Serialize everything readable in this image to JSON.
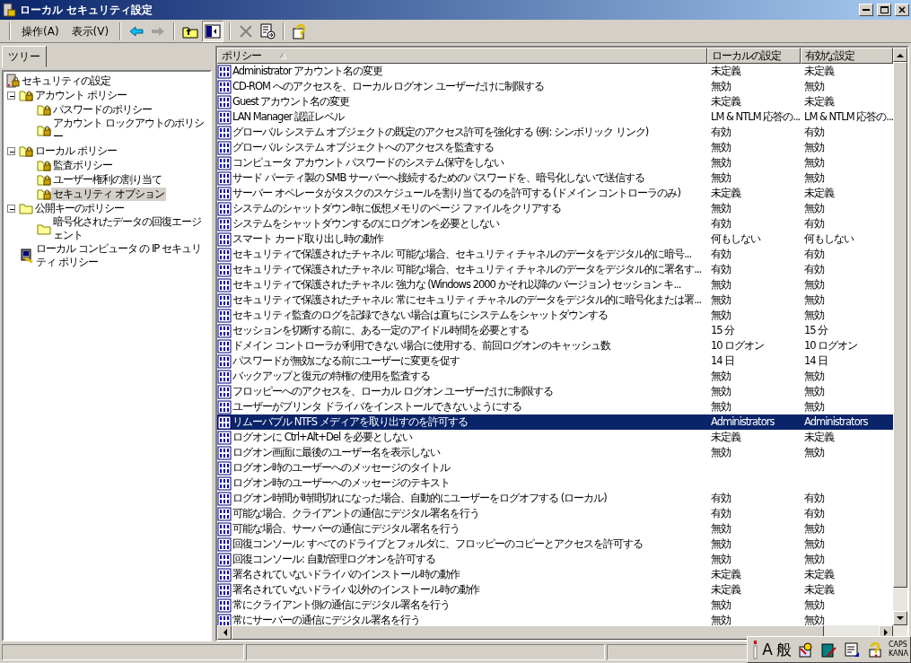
{
  "window": {
    "title": "ローカル セキュリティ設定"
  },
  "menu": [
    {
      "label": "操作(A)"
    },
    {
      "label": "表示(V)"
    }
  ],
  "tree_tab": {
    "label": "ツリー",
    "selected": true
  },
  "tree": {
    "label": "セキュリティの設定",
    "kind": "root",
    "children": [
      {
        "label": "アカウント ポリシー",
        "kind": "folder",
        "expanded": true,
        "selected": false,
        "children": [
          {
            "label": "パスワードのポリシー",
            "kind": "folder",
            "selected": false
          },
          {
            "label": "アカウント ロックアウトのポリシー",
            "kind": "folder",
            "selected": false
          }
        ]
      },
      {
        "label": "ローカル ポリシー",
        "kind": "folder",
        "expanded": true,
        "selected": false,
        "children": [
          {
            "label": "監査ポリシー",
            "kind": "folder",
            "selected": false
          },
          {
            "label": "ユーザー権利の割り当て",
            "kind": "folder",
            "selected": false
          },
          {
            "label": "セキュリティ オプション",
            "kind": "folder",
            "selected": true
          }
        ]
      },
      {
        "label": "公開キーのポリシー",
        "kind": "plain",
        "expanded": true,
        "selected": false,
        "children": [
          {
            "label": "暗号化されたデータの回復エージェント",
            "kind": "plain",
            "selected": false
          }
        ]
      },
      {
        "label": "ローカル コンピュータ の IP セキュリティ ポリシー",
        "kind": "computer",
        "selected": false
      }
    ]
  },
  "table": {
    "columns": [
      {
        "label": "ポリシー",
        "sorted": true
      },
      {
        "label": "ローカルの設定",
        "sorted": false
      },
      {
        "label": "有効な設定",
        "sorted": false
      }
    ],
    "rows": [
      {
        "policy": "Administrator アカウント名の変更",
        "local": "未定義",
        "effective": "未定義",
        "selected": false
      },
      {
        "policy": "CD-ROM へのアクセスを、ローカル ログオン ユーザーだけに制限する",
        "local": "無効",
        "effective": "無効",
        "selected": false
      },
      {
        "policy": "Guest アカウント名の変更",
        "local": "未定義",
        "effective": "未定義",
        "selected": false
      },
      {
        "policy": "LAN Manager 認証レベル",
        "local": "LM & NTLM 応答の...",
        "effective": "LM & NTLM 応答の...",
        "selected": false
      },
      {
        "policy": "グローバル システム オブジェクトの既定のアクセス許可を強化する (例: シンボリック リンク)",
        "local": "有効",
        "effective": "有効",
        "selected": false
      },
      {
        "policy": "グローバル システム オブジェクトへのアクセスを監査する",
        "local": "無効",
        "effective": "無効",
        "selected": false
      },
      {
        "policy": "コンピュータ アカウント パスワードのシステム保守をしない",
        "local": "無効",
        "effective": "無効",
        "selected": false
      },
      {
        "policy": "サード パーティ製の SMB サーバーへ接続するためのパスワードを、暗号化しないで送信する",
        "local": "無効",
        "effective": "無効",
        "selected": false
      },
      {
        "policy": "サーバー オペレータがタスクのスケジュールを割り当てるのを許可する (ドメイン コントローラのみ)",
        "local": "未定義",
        "effective": "未定義",
        "selected": false
      },
      {
        "policy": "システムのシャットダウン時に仮想メモリのページ ファイルをクリアする",
        "local": "無効",
        "effective": "無効",
        "selected": false
      },
      {
        "policy": "システムをシャットダウンするのにログオンを必要としない",
        "local": "有効",
        "effective": "有効",
        "selected": false
      },
      {
        "policy": "スマート カード取り出し時の動作",
        "local": "何もしない",
        "effective": "何もしない",
        "selected": false
      },
      {
        "policy": "セキュリティで保護されたチャネル: 可能な場合、セキュリティ チャネルのデータをデジタル的に暗号...",
        "local": "有効",
        "effective": "有効",
        "selected": false
      },
      {
        "policy": "セキュリティで保護されたチャネル: 可能な場合、セキュリティ チャネルのデータをデジタル的に署名す...",
        "local": "有効",
        "effective": "有効",
        "selected": false
      },
      {
        "policy": "セキュリティで保護されたチャネル: 強力な (Windows 2000 かそれ以降のバージョン) セッション キ...",
        "local": "無効",
        "effective": "無効",
        "selected": false
      },
      {
        "policy": "セキュリティで保護されたチャネル: 常にセキュリティ チャネルのデータをデジタル的に暗号化または署...",
        "local": "無効",
        "effective": "無効",
        "selected": false
      },
      {
        "policy": "セキュリティ監査のログを記録できない場合は直ちにシステムをシャットダウンする",
        "local": "無効",
        "effective": "無効",
        "selected": false
      },
      {
        "policy": "セッションを切断する前に、ある一定のアイドル時間を必要とする",
        "local": "15 分",
        "effective": "15 分",
        "selected": false
      },
      {
        "policy": "ドメイン コントローラが利用できない場合に使用する、前回ログオンのキャッシュ数",
        "local": "10 ログオン",
        "effective": "10 ログオン",
        "selected": false
      },
      {
        "policy": "パスワードが無効になる前にユーザーに変更を促す",
        "local": "14 日",
        "effective": "14 日",
        "selected": false
      },
      {
        "policy": "バックアップと復元の特権の使用を監査する",
        "local": "無効",
        "effective": "無効",
        "selected": false
      },
      {
        "policy": "フロッピーへのアクセスを、ローカル ログオン ユーザーだけに制限する",
        "local": "無効",
        "effective": "無効",
        "selected": false
      },
      {
        "policy": "ユーザーがプリンタ ドライバをインストールできないようにする",
        "local": "無効",
        "effective": "無効",
        "selected": false
      },
      {
        "policy": "リムーバブル NTFS メディアを取り出すのを許可する",
        "local": "Administrators",
        "effective": "Administrators",
        "selected": true
      },
      {
        "policy": "ログオンに Ctrl+Alt+Del を必要としない",
        "local": "未定義",
        "effective": "未定義",
        "selected": false
      },
      {
        "policy": "ログオン画面に最後のユーザー名を表示しない",
        "local": "無効",
        "effective": "無効",
        "selected": false
      },
      {
        "policy": "ログオン時のユーザーへのメッセージのタイトル",
        "selected": false
      },
      {
        "policy": "ログオン時のユーザーへのメッセージのテキスト",
        "selected": false
      },
      {
        "policy": "ログオン時間が時間切れになった場合、自動的にユーザーをログオフする (ローカル)",
        "local": "有効",
        "effective": "有効",
        "selected": false
      },
      {
        "policy": "可能な場合、クライアントの通信にデジタル署名を行う",
        "local": "有効",
        "effective": "有効",
        "selected": false
      },
      {
        "policy": "可能な場合、サーバーの通信にデジタル署名を行う",
        "local": "無効",
        "effective": "無効",
        "selected": false
      },
      {
        "policy": "回復コンソール: すべてのドライブとフォルダに、フロッピーのコピーとアクセスを許可する",
        "local": "無効",
        "effective": "無効",
        "selected": false
      },
      {
        "policy": "回復コンソール: 自動管理ログオンを許可する",
        "local": "無効",
        "effective": "無効",
        "selected": false
      },
      {
        "policy": "署名されていないドライバのインストール時の動作",
        "local": "未定義",
        "effective": "未定義",
        "selected": false
      },
      {
        "policy": "署名されていないドライバ以外のインストール時の動作",
        "local": "未定義",
        "effective": "未定義",
        "selected": false
      },
      {
        "policy": "常にクライアント側の通信にデジタル署名を行う",
        "local": "無効",
        "effective": "無効",
        "selected": false
      },
      {
        "policy": "常にサーバーの通信にデジタル署名を行う",
        "local": "無効",
        "effective": "無効",
        "selected": false
      }
    ]
  },
  "ime_bar": {
    "mode": "A",
    "kanji": "般",
    "caps": "CAPS",
    "kana": "KANA"
  }
}
